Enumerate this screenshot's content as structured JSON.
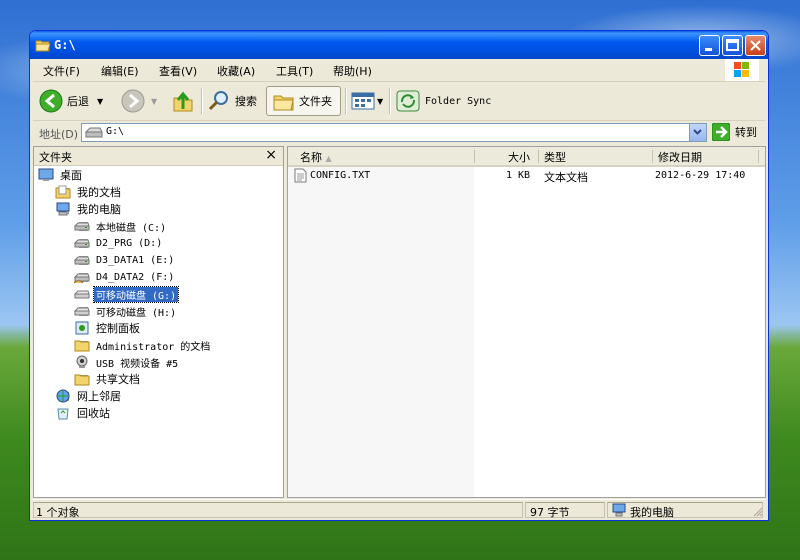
{
  "window": {
    "title": "G:\\"
  },
  "menu": {
    "items": [
      "文件(F)",
      "编辑(E)",
      "查看(V)",
      "收藏(A)",
      "工具(T)",
      "帮助(H)"
    ]
  },
  "toolbar": {
    "back_label": "后退",
    "search_label": "搜索",
    "folders_label": "文件夹",
    "folder_sync_label": "Folder Sync"
  },
  "address": {
    "label": "地址(D)",
    "value": "G:\\",
    "go_label": "转到"
  },
  "left_pane": {
    "title": "文件夹",
    "close_symbol": "×",
    "tree": [
      {
        "label": "桌面",
        "icon": "desktop-icon"
      },
      {
        "label": "我的文档",
        "icon": "my-documents-icon"
      },
      {
        "label": "我的电脑",
        "icon": "my-computer-icon"
      },
      {
        "label": "本地磁盘 (C:)",
        "icon": "hard-drive-icon"
      },
      {
        "label": "D2_PRG (D:)",
        "icon": "hard-drive-icon"
      },
      {
        "label": "D3_DATA1 (E:)",
        "icon": "hard-drive-icon"
      },
      {
        "label": "D4_DATA2 (F:)",
        "icon": "shared-drive-icon"
      },
      {
        "label": "可移动磁盘 (G:)",
        "icon": "removable-drive-icon",
        "selected": true
      },
      {
        "label": "可移动磁盘 (H:)",
        "icon": "removable-drive-icon"
      },
      {
        "label": "控制面板",
        "icon": "control-panel-icon"
      },
      {
        "label": "Administrator 的文档",
        "icon": "folder-icon"
      },
      {
        "label": "USB 视频设备 #5",
        "icon": "webcam-icon"
      },
      {
        "label": "共享文档",
        "icon": "folder-icon"
      },
      {
        "label": "网上邻居",
        "icon": "network-icon"
      },
      {
        "label": "回收站",
        "icon": "recycle-bin-icon"
      }
    ]
  },
  "file_list": {
    "columns": [
      "名称",
      "大小",
      "类型",
      "修改日期"
    ],
    "rows": [
      {
        "name": "CONFIG.TXT",
        "size": "1 KB",
        "type": "文本文档",
        "modified": "2012-6-29 17:40"
      }
    ]
  },
  "status": {
    "objects": "1 个对象",
    "size": "97 字节",
    "location": "我的电脑"
  },
  "colors": {
    "titlebar": "#0058ee",
    "selection": "#316ac5",
    "window_bg": "#ece9d8"
  }
}
